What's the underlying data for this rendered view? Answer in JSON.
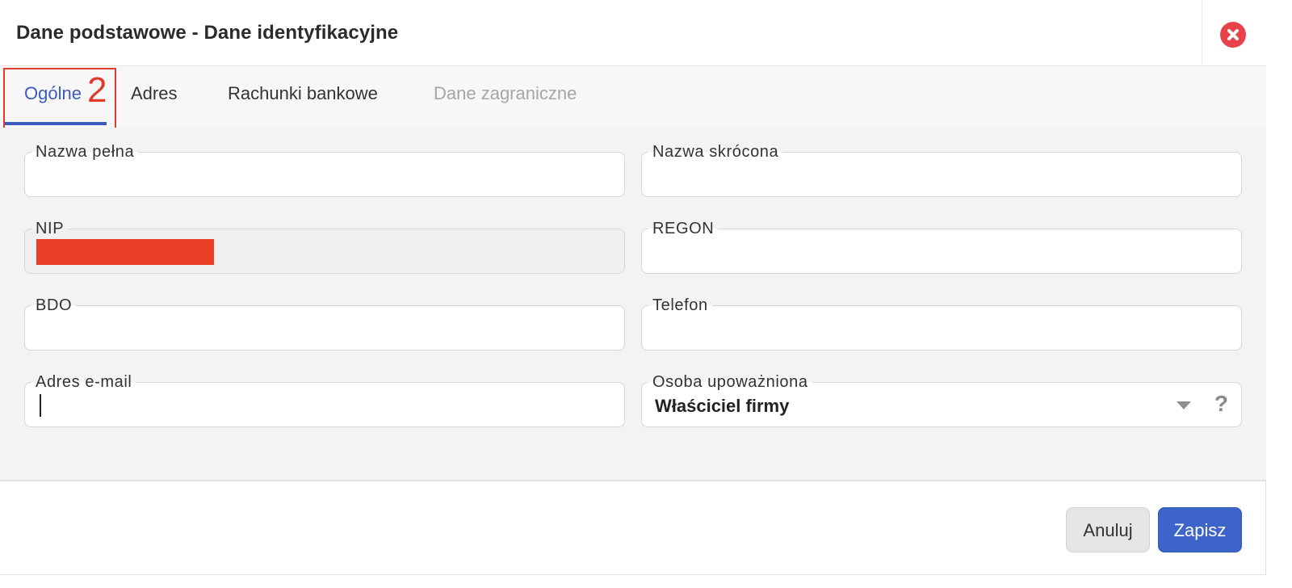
{
  "dialog": {
    "title": "Dane podstawowe - Dane identyfikacyjne",
    "close_icon": "close-circle-icon",
    "accent_color": "#3b5bbf",
    "danger_color": "#e8424a"
  },
  "tabs": [
    {
      "label": "Ogólne",
      "state": "active"
    },
    {
      "label": "Adres",
      "state": "normal"
    },
    {
      "label": "Rachunki bankowe",
      "state": "normal"
    },
    {
      "label": "Dane zagraniczne",
      "state": "disabled"
    }
  ],
  "annotation": {
    "badge": "2",
    "color": "#e03b2a"
  },
  "form": {
    "nazwa_pelna": {
      "label": "Nazwa pełna",
      "value": ""
    },
    "nazwa_skrocona": {
      "label": "Nazwa skrócona",
      "value": ""
    },
    "nip": {
      "label": "NIP",
      "value": "",
      "redacted": true
    },
    "regon": {
      "label": "REGON",
      "value": ""
    },
    "bdo": {
      "label": "BDO",
      "value": ""
    },
    "telefon": {
      "label": "Telefon",
      "value": ""
    },
    "email": {
      "label": "Adres e-mail",
      "value": ""
    },
    "osoba": {
      "label": "Osoba upoważniona",
      "value": "Właściciel firmy",
      "help": "?"
    }
  },
  "footer": {
    "cancel_label": "Anuluj",
    "save_label": "Zapisz"
  }
}
